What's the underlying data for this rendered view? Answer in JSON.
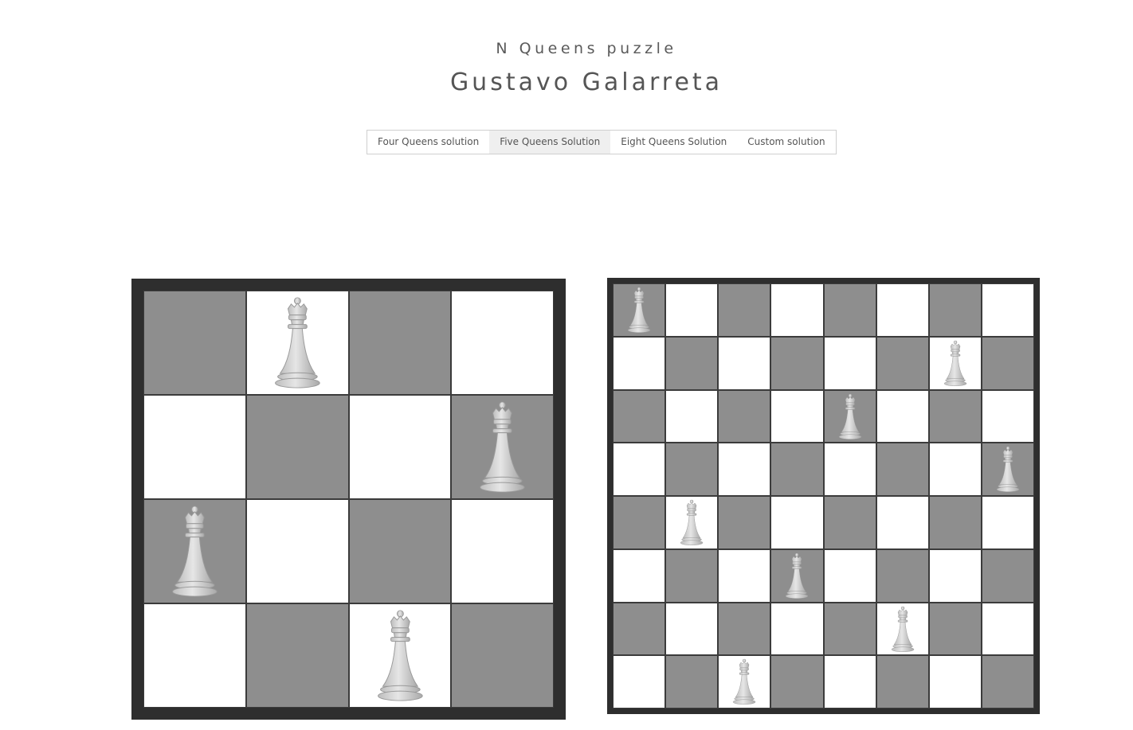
{
  "header": {
    "subtitle": "N Queens puzzle",
    "title": "Gustavo Galarreta"
  },
  "tabs": [
    {
      "label": "Four Queens solution",
      "active": false
    },
    {
      "label": "Five Queens Solution",
      "active": true
    },
    {
      "label": "Eight Queens Solution",
      "active": false
    },
    {
      "label": "Custom solution",
      "active": false
    }
  ],
  "colors": {
    "dark_square": "#8e8e8e",
    "light_square": "#ffffff",
    "board_frame": "#2e2e2e",
    "queen": "#e6e6e6"
  },
  "boards": [
    {
      "name": "board-4",
      "size": 4,
      "queens": [
        1,
        3,
        0,
        2
      ],
      "icon": "white-queen-icon"
    },
    {
      "name": "board-8",
      "size": 8,
      "queens": [
        0,
        6,
        4,
        7,
        1,
        3,
        5,
        2
      ],
      "icon": "white-queen-icon"
    }
  ]
}
